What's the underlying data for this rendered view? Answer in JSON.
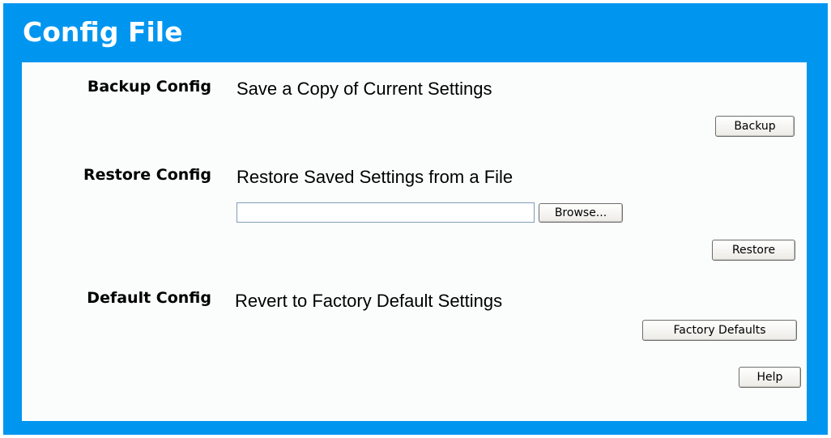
{
  "page": {
    "title": "Config File"
  },
  "backup": {
    "label": "Backup Config",
    "description": "Save a Copy of Current Settings",
    "button_label": "Backup"
  },
  "restore": {
    "label": "Restore Config",
    "description": "Restore Saved Settings from a File",
    "file_input_value": "",
    "browse_label": "Browse...",
    "button_label": "Restore"
  },
  "defaults": {
    "label": "Default Config",
    "description": "Revert to Factory Default Settings",
    "button_label": "Factory Defaults"
  },
  "help": {
    "button_label": "Help"
  },
  "colors": {
    "frame_blue": "#0096f0",
    "panel_bg": "#fbfdfd",
    "title_text": "#ffffff"
  }
}
